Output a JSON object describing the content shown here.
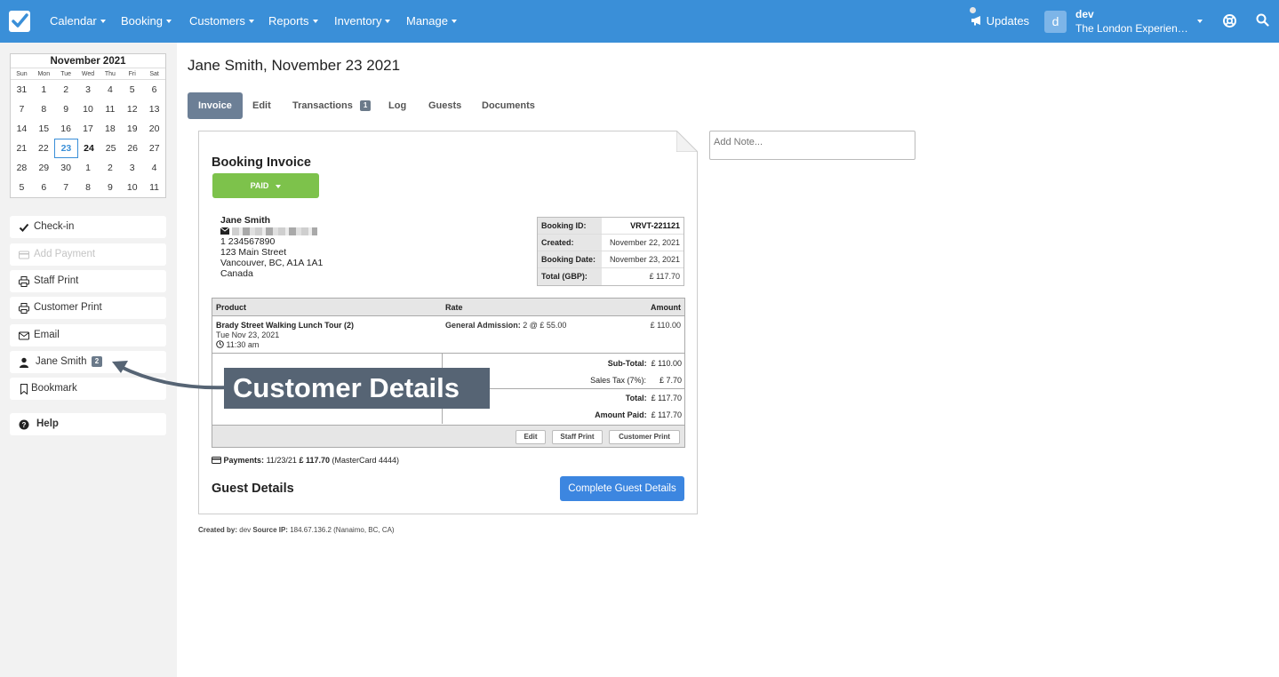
{
  "nav": {
    "items": [
      "Calendar",
      "Booking",
      "Customers",
      "Reports",
      "Inventory",
      "Manage"
    ],
    "updates_label": "Updates",
    "user_initial": "d",
    "user_name": "dev",
    "user_org": "The London Experience Ltd",
    "brand_color": "#3a8fd8"
  },
  "calendar": {
    "title": "November 2021",
    "dow": [
      "Sun",
      "Mon",
      "Tue",
      "Wed",
      "Thu",
      "Fri",
      "Sat"
    ],
    "weeks": [
      [
        "31",
        "1",
        "2",
        "3",
        "4",
        "5",
        "6"
      ],
      [
        "7",
        "8",
        "9",
        "10",
        "11",
        "12",
        "13"
      ],
      [
        "14",
        "15",
        "16",
        "17",
        "18",
        "19",
        "20"
      ],
      [
        "21",
        "22",
        "23",
        "24",
        "25",
        "26",
        "27"
      ],
      [
        "28",
        "29",
        "30",
        "1",
        "2",
        "3",
        "4"
      ],
      [
        "5",
        "6",
        "7",
        "8",
        "9",
        "10",
        "11"
      ]
    ],
    "selected": "23",
    "today": "24"
  },
  "sidebar": {
    "checkin": "Check-in",
    "add_payment": "Add Payment",
    "staff_print": "Staff Print",
    "customer_print": "Customer Print",
    "email": "Email",
    "customer": "Jane Smith",
    "customer_badge": "2",
    "bookmark": "Bookmark",
    "help": "Help"
  },
  "page": {
    "title": "Jane Smith, November 23 2021",
    "tabs": [
      "Invoice",
      "Edit",
      "Transactions",
      "Log",
      "Guests",
      "Documents"
    ],
    "transactions_badge": "1",
    "note_placeholder": "Add Note..."
  },
  "invoice": {
    "title": "Booking Invoice",
    "status": "PAID",
    "customer": {
      "name": "Jane Smith",
      "phone": "1 234567890",
      "street": "123 Main Street",
      "city": "Vancouver, BC, A1A 1A1",
      "country": "Canada"
    },
    "meta": {
      "booking_id_label": "Booking ID:",
      "booking_id": "VRVT-221121",
      "created_label": "Created:",
      "created": "November 22, 2021",
      "booking_date_label": "Booking Date:",
      "booking_date": "November 23, 2021",
      "total_label": "Total (GBP):",
      "total": "£ 117.70"
    },
    "columns": {
      "product": "Product",
      "rate": "Rate",
      "amount": "Amount"
    },
    "line": {
      "product": "Brady Street Walking Lunch Tour (2)",
      "date": "Tue Nov 23, 2021",
      "time": "11:30 am",
      "rate_label": "General Admission:",
      "rate_detail": "2 @ £ 55.00",
      "amount": "£ 110.00"
    },
    "totals": {
      "subtotal_label": "Sub-Total:",
      "subtotal": "£ 110.00",
      "tax_label": "Sales Tax (7%):",
      "tax": "£ 7.70",
      "total_label": "Total:",
      "total": "£ 117.70",
      "paid_label": "Amount Paid:",
      "paid": "£ 117.70"
    },
    "buttons": {
      "edit": "Edit",
      "staff_print": "Staff Print",
      "customer_print": "Customer Print"
    },
    "payments": {
      "label": "Payments:",
      "date": "11/23/21",
      "amount": "£ 117.70",
      "method": "(MasterCard 4444)"
    },
    "guest_title": "Guest Details",
    "guest_button": "Complete Guest Details"
  },
  "footer": {
    "created_by_label": "Created by:",
    "created_by": "dev",
    "source_ip_label": "Source IP:",
    "source_ip": "184.67.136.2 (Nanaimo, BC, CA)"
  },
  "annotation": {
    "label": "Customer Details"
  }
}
